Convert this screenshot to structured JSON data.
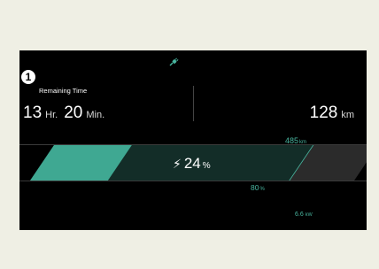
{
  "callout": "1",
  "icons": {
    "charging": "plug-charging-icon",
    "bolt": "lightning-bolt-icon"
  },
  "remaining": {
    "label": "Remaining Time",
    "hours": "13",
    "hours_unit": "Hr.",
    "minutes": "20",
    "minutes_unit": "Min."
  },
  "range": {
    "value": "128",
    "unit": "km"
  },
  "max_range": {
    "value": "485",
    "unit": "km"
  },
  "battery": {
    "percent": "24",
    "unit": "%",
    "level": 0.24,
    "target_percent": "80",
    "target_unit": "%",
    "target_level": 0.8
  },
  "charging_power": {
    "value": "6.6",
    "unit": "kW"
  },
  "colors": {
    "accent": "#49b6a0",
    "fill": "#3fa892",
    "track_target": "#132d28",
    "track": "#2b2b2b",
    "screen": "#000000",
    "page": "#efefe4"
  }
}
